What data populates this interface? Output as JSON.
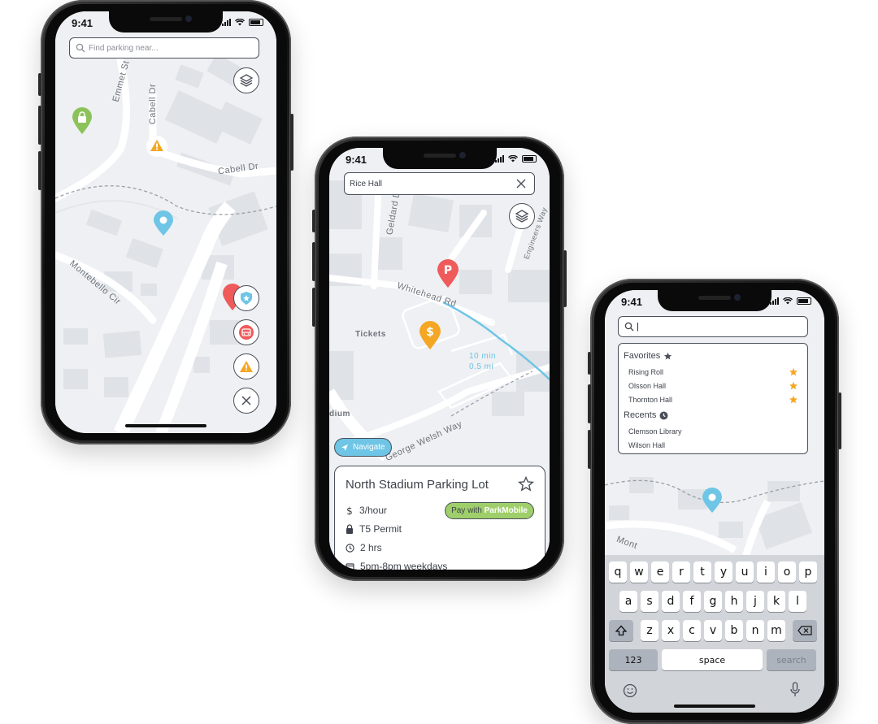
{
  "status": {
    "time": "9:41"
  },
  "screen1": {
    "search_placeholder": "Find parking near...",
    "streets": [
      "Emmet St",
      "Cabell Dr",
      "Cabell Dr",
      "Montebello Cir"
    ],
    "layers_icon": "layers-icon",
    "fab_icons": [
      "shield-star-icon",
      "bus-icon",
      "warning-icon",
      "close-icon"
    ]
  },
  "screen2": {
    "search_value": "Rice Hall",
    "streets": [
      "Geldard Dr",
      "Whitehead Rd",
      "Engineers Way",
      "George Welsh Way"
    ],
    "poi_tickets": "Tickets",
    "poi_stadium": "dium",
    "route_time": "10 min",
    "route_distance": "0.5 mi",
    "navigate_label": "Navigate",
    "card": {
      "title": "North Stadium Parking Lot",
      "price": "3/hour",
      "permit": "T5 Permit",
      "duration": "2 hrs",
      "hours": "5pm-8pm weekdays",
      "pay_prefix": "Pay with ",
      "pay_brand": "ParkMobile"
    }
  },
  "screen3": {
    "search_value": "|",
    "favorites_heading": "Favorites",
    "favorites": [
      "Rising Roll",
      "Olsson Hall",
      "Thornton Hall"
    ],
    "recents_heading": "Recents",
    "recents": [
      "Clemson Library",
      "Wilson Hall"
    ],
    "street_partial": "Mont",
    "keyboard": {
      "row1": [
        "q",
        "w",
        "e",
        "r",
        "t",
        "y",
        "u",
        "i",
        "o",
        "p"
      ],
      "row2": [
        "a",
        "s",
        "d",
        "f",
        "g",
        "h",
        "j",
        "k",
        "l"
      ],
      "row3": [
        "z",
        "x",
        "c",
        "v",
        "b",
        "n",
        "m"
      ],
      "numbers_label": "123",
      "space_label": "space",
      "search_label": "search"
    }
  },
  "colors": {
    "pin_blue": "#6ec5e6",
    "pin_green": "#8cc25a",
    "pin_red": "#ef5a5a",
    "pin_orange": "#f5a623",
    "star": "#f5a623"
  }
}
